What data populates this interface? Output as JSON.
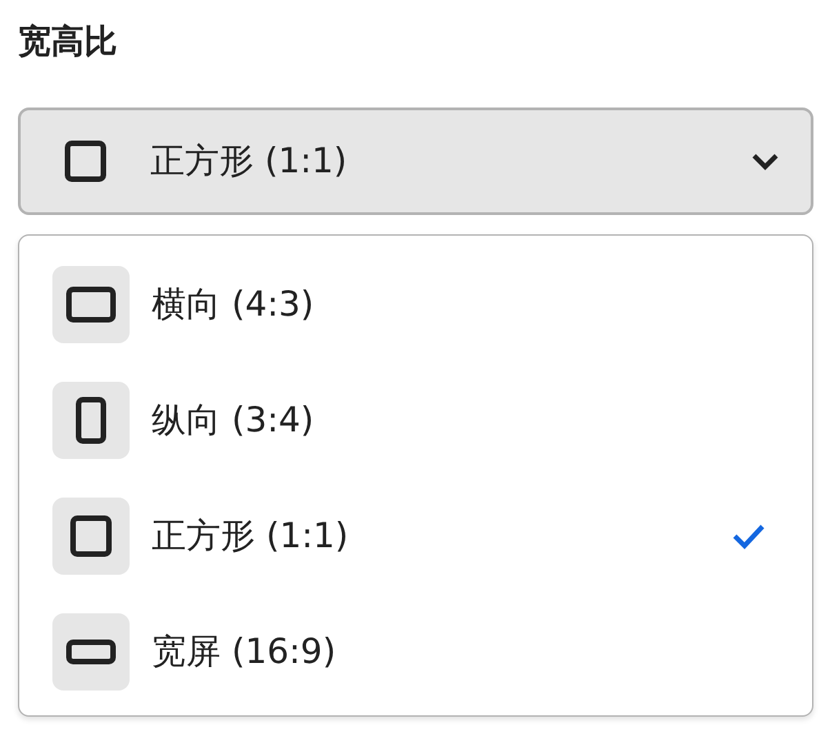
{
  "title": "宽高比",
  "select": {
    "kind": "square",
    "value": "正方形 (1:1)",
    "expanded": true
  },
  "options": [
    {
      "kind": "landscape",
      "label": "横向 (4:3)",
      "selected": false
    },
    {
      "kind": "portrait",
      "label": "纵向 (3:4)",
      "selected": false
    },
    {
      "kind": "square",
      "label": "正方形 (1:1)",
      "selected": true
    },
    {
      "kind": "wide",
      "label": "宽屏 (16:9)",
      "selected": false
    }
  ]
}
